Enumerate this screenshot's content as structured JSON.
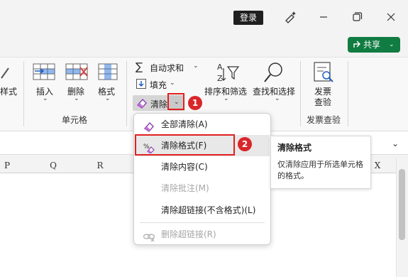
{
  "titlebar": {
    "login_label": "登录",
    "icons": [
      "pen-sparkle-icon",
      "minimize-icon",
      "restore-icon",
      "close-icon"
    ]
  },
  "share": {
    "label": "共享",
    "icon": "share-icon"
  },
  "ribbon": {
    "partial_label": "样式",
    "cells_group": {
      "title": "单元格",
      "insert": "插入",
      "delete": "删除",
      "format": "格式"
    },
    "editing": {
      "autosum": "自动求和",
      "fill": "填充",
      "clear": "清除",
      "sort_filter": "排序和筛选",
      "find_select": "查找和选择"
    },
    "invoice_group": {
      "title": "发票查验",
      "button_line1": "发票",
      "button_line2": "查验"
    }
  },
  "columns": [
    "P",
    "Q",
    "R",
    "X"
  ],
  "menu": {
    "items": [
      {
        "label": "全部清除(A)",
        "icon": "eraser-icon",
        "disabled": false
      },
      {
        "label": "清除格式(F)",
        "icon": "clear-format-icon",
        "disabled": false
      },
      {
        "label": "清除内容(C)",
        "icon": "",
        "disabled": false
      },
      {
        "label": "清除批注(M)",
        "icon": "",
        "disabled": true
      },
      {
        "label": "清除超链接(不含格式)(L)",
        "icon": "",
        "disabled": false
      },
      {
        "label": "删除超链接(R)",
        "icon": "unlink-icon",
        "disabled": true
      }
    ]
  },
  "tooltip": {
    "title": "清除格式",
    "body": "仅清除应用于所选单元格的格式。"
  },
  "annotations": {
    "step1": "1",
    "step2": "2",
    "color": "#e02020"
  }
}
